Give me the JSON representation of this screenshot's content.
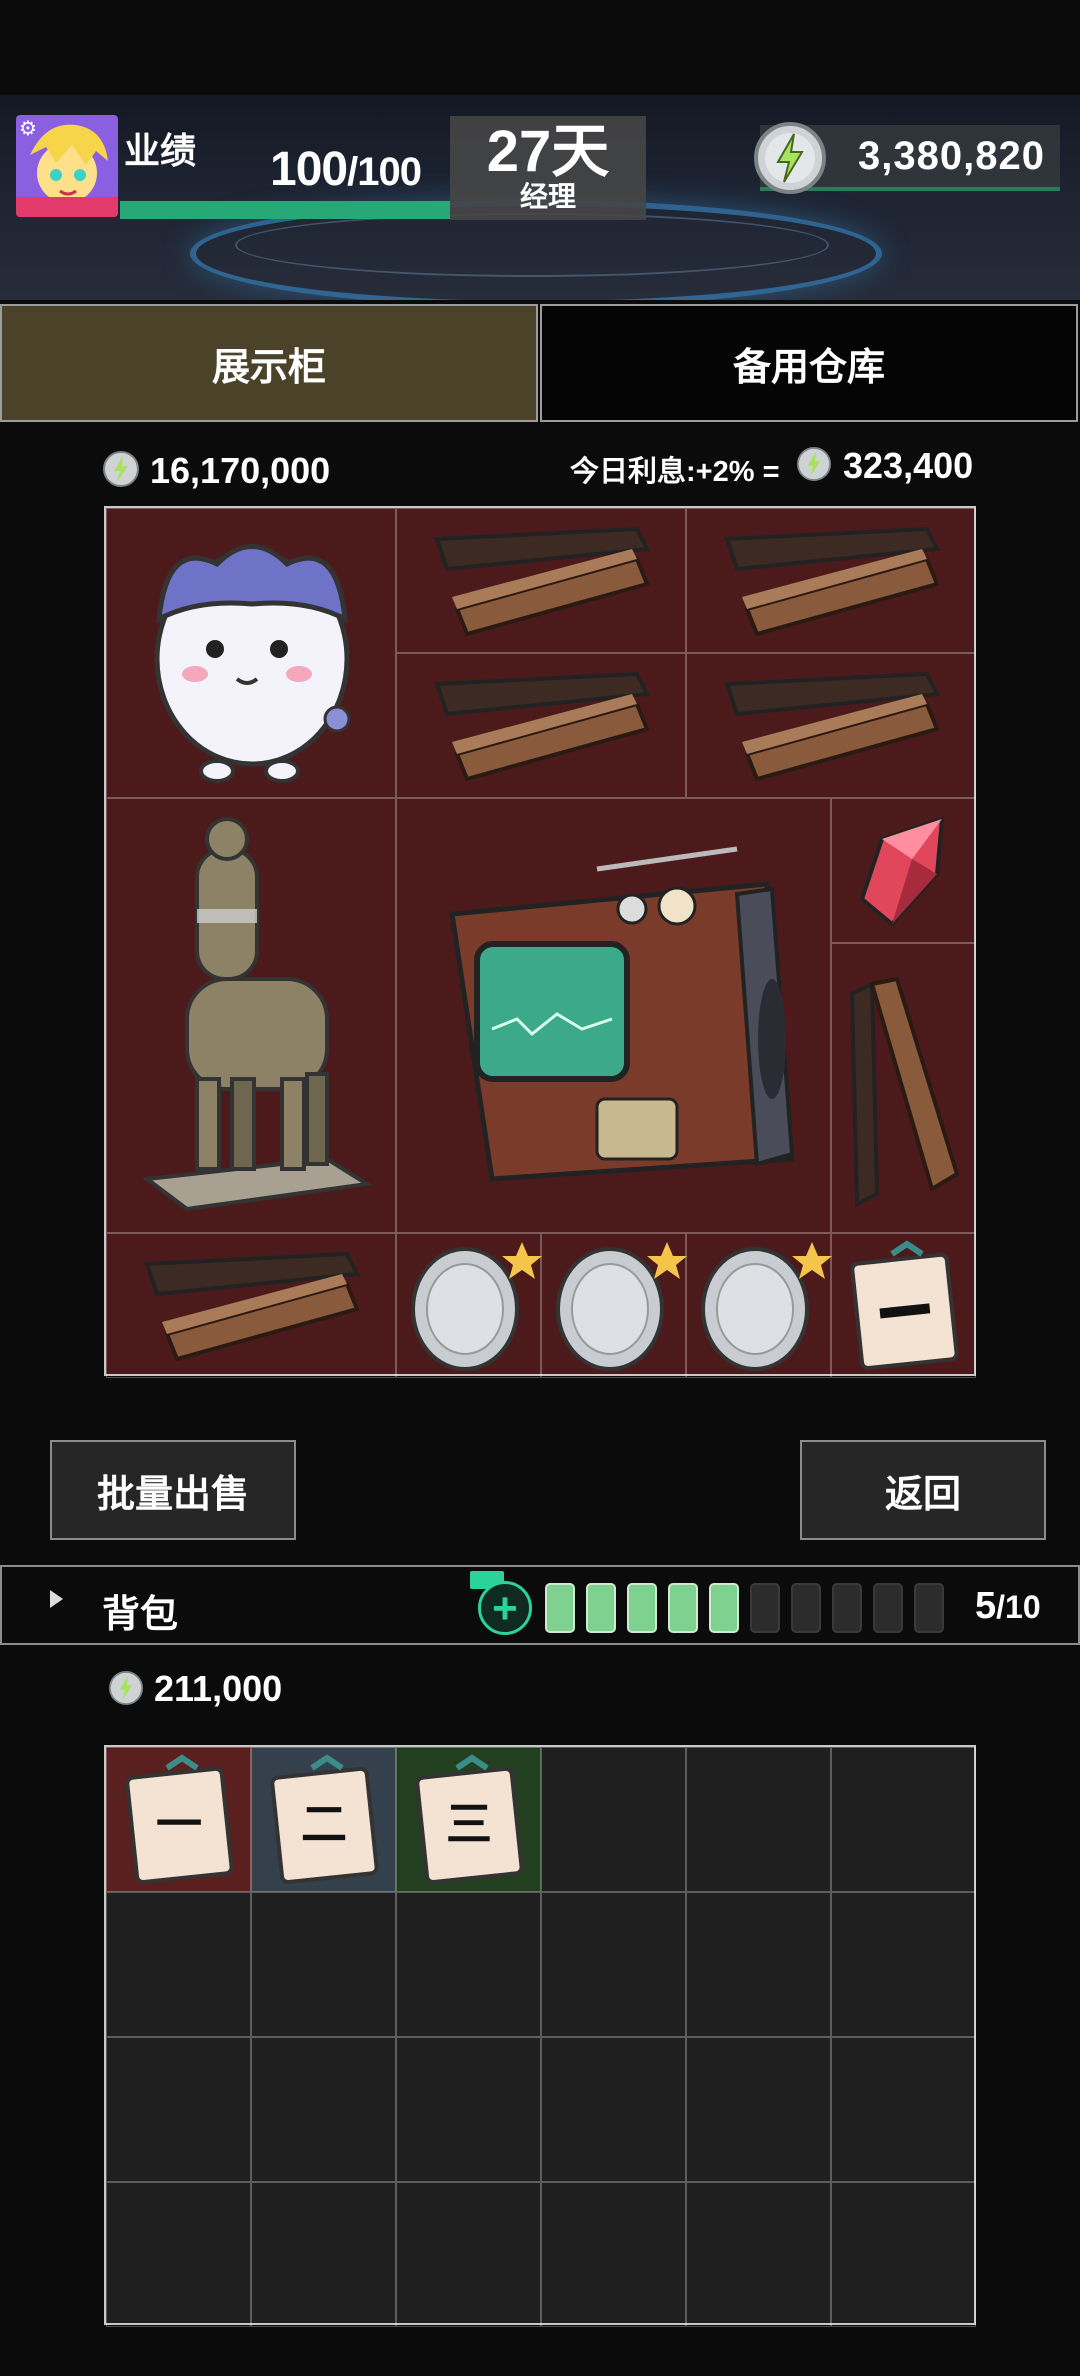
{
  "header": {
    "performance_label": "业绩",
    "performance_value": "100",
    "performance_max": "/100",
    "performance_progress": 1.0,
    "day_value": "27天",
    "role": "经理",
    "money": "3,380,820"
  },
  "tabs": [
    {
      "label": "展示柜",
      "selected": true
    },
    {
      "label": "备用仓库",
      "selected": false
    }
  ],
  "showcase": {
    "total_value": "16,170,000",
    "interest_text": "今日利息:+2% =",
    "interest_value": "323,400",
    "items": [
      "cat-plush",
      "wood-box",
      "wood-box",
      "wood-box",
      "wood-box",
      "alpaca-statue",
      "retro-tv",
      "crystal",
      "wood-box",
      "wood-box",
      "silver-coin",
      "silver-coin",
      "silver-coin",
      "ticket-1"
    ]
  },
  "buttons": {
    "bulk_sell": "批量出售",
    "back": "返回"
  },
  "backpack": {
    "title": "背包",
    "capacity_used": "5",
    "capacity_max": "/10",
    "total_value": "211,000",
    "items": [
      {
        "label": "一",
        "bg": "#5a1f1f"
      },
      {
        "label": "二",
        "bg": "#34414d"
      },
      {
        "label": "三",
        "bg": "#22401f"
      }
    ]
  },
  "colors": {
    "accent_green": "#28a877",
    "showcase_bg": "#4d1a1c",
    "tab_selected": "#4a4329"
  }
}
